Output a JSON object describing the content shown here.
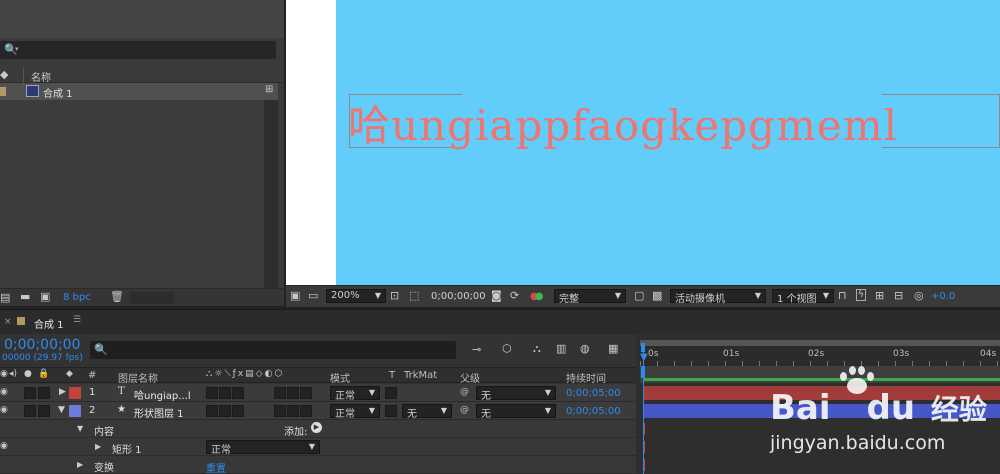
{
  "project": {
    "search_icon": "🔍",
    "col_name": "名称",
    "item_name": "合成 1",
    "bpc": "8 bpc"
  },
  "viewer": {
    "comp_text": "哈ungiappfaogkepgmeml",
    "zoom": "200%",
    "timecode": "0;00;00;00",
    "resolution": "完整",
    "camera": "活动摄像机",
    "views": "1 个视图",
    "exposure": "+0.0"
  },
  "timeline": {
    "tab": "合成 1",
    "menu_icon": "☰",
    "timecode": "0;00;00;00",
    "frames": "00000 (29.97 fps)",
    "search_icon": "🔍",
    "columns": {
      "num": "#",
      "layer_name": "图层名称",
      "mode": "模式",
      "t": "T",
      "trkmat": "TrkMat",
      "parent": "父级",
      "duration": "持续时间"
    },
    "ruler": [
      "0s",
      "01s",
      "02s",
      "03s",
      "04s"
    ],
    "layers": [
      {
        "num": "1",
        "type_icon": "T",
        "name": "哈ungiap...l",
        "mode": "正常",
        "trkmat": "",
        "parent": "无",
        "duration": "0;00;05;00",
        "color": "#c4413c"
      },
      {
        "num": "2",
        "type_icon": "★",
        "name": "形状图层 1",
        "mode": "正常",
        "trkmat": "无",
        "parent": "无",
        "duration": "0;00;05;00",
        "color": "#6f7bd8"
      }
    ],
    "content_label": "内容",
    "add_label": "添加:",
    "rect_label": "矩形 1",
    "rect_mode": "正常",
    "transform_label": "变换",
    "reset_label": "重置"
  },
  "watermark": {
    "brand": "Bai",
    "brand2": "du",
    "cn": "经验",
    "url": "jingyan.baidu.com"
  },
  "colors": {
    "comp_bg": "#62cdfb",
    "text": "#f07470",
    "accent": "#2d8ceb",
    "track_red": "#a03c3a",
    "track_blue": "#4657c8"
  }
}
